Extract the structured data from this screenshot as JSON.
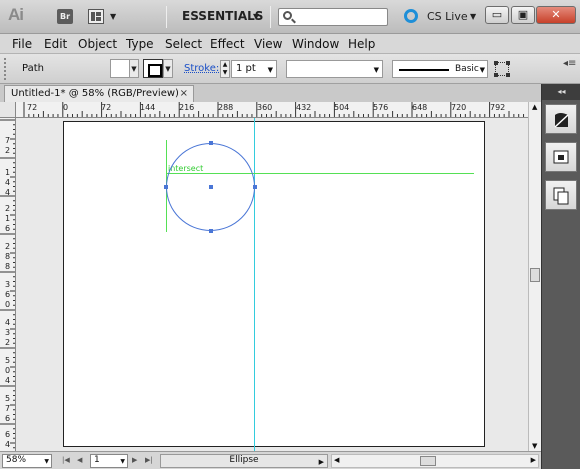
{
  "app": {
    "logo": "Ai",
    "bridge_label": "Br",
    "workspace": "ESSENTIALS",
    "search_placeholder": "",
    "cs_live": "CS Live"
  },
  "window_controls": {
    "minimize": "▭",
    "restore": "▣",
    "close": "✕"
  },
  "menu": [
    "File",
    "Edit",
    "Object",
    "Type",
    "Select",
    "Effect",
    "View",
    "Window",
    "Help"
  ],
  "control_bar": {
    "selection_type": "Path",
    "stroke_label": "Stroke:",
    "stroke_weight": "1 pt",
    "variable_width": "",
    "brush_label": "Basic",
    "panel_menu": "◂≡"
  },
  "document": {
    "tab_title": "Untitled-1* @ 58% (RGB/Preview)",
    "tab_close": "×"
  },
  "ruler_h": [
    "72",
    "0",
    "72",
    "144",
    "216",
    "288",
    "360",
    "432",
    "504",
    "576",
    "648",
    "720",
    "792"
  ],
  "ruler_v": [
    "7",
    "2",
    "1",
    "4",
    "4",
    "2",
    "1",
    "6",
    "2",
    "8",
    "8",
    "3",
    "6",
    "0",
    "4",
    "3",
    "2",
    "5",
    "0",
    "4",
    "5",
    "7",
    "6",
    "6",
    "4"
  ],
  "canvas": {
    "smart_guide_label": "intersect"
  },
  "status_bar": {
    "zoom": "58%",
    "page": "1",
    "current_tool": "Ellipse"
  },
  "dock": {
    "header": "◂◂"
  }
}
